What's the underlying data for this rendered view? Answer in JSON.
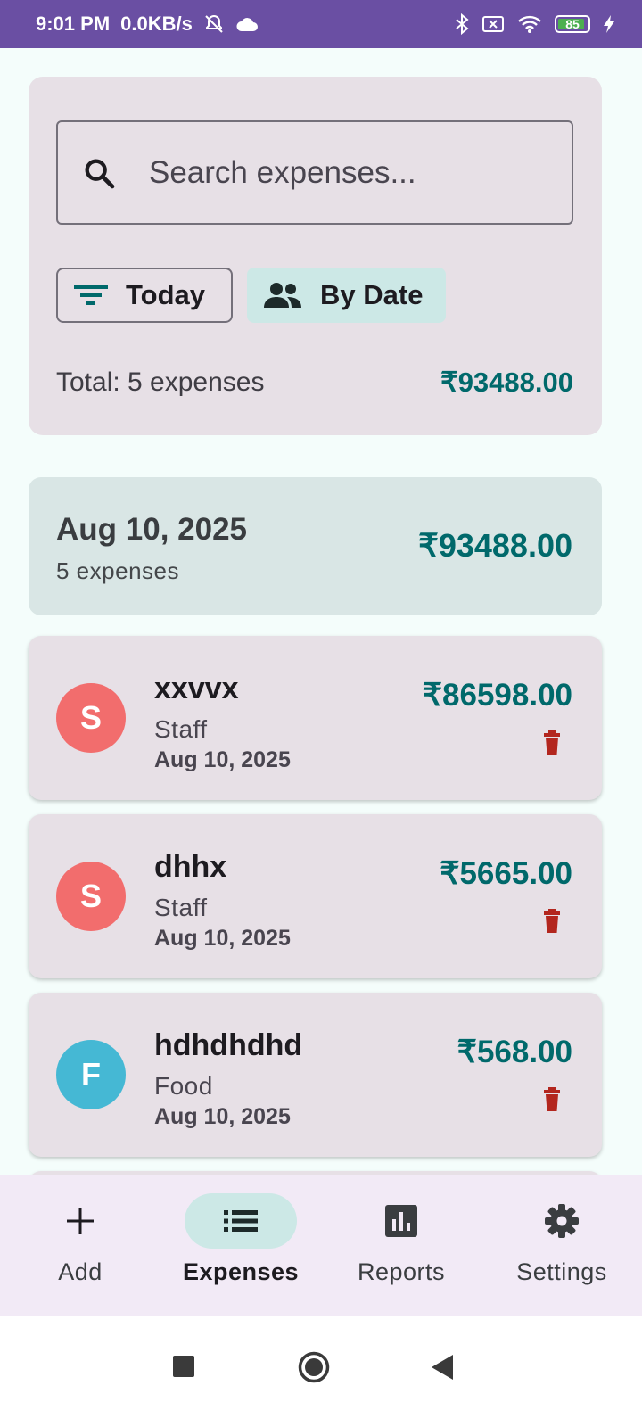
{
  "status_bar": {
    "time": "9:01 PM",
    "speed": "0.0KB/s",
    "battery": "85",
    "background": "#6A4FA3"
  },
  "search": {
    "placeholder": "Search expenses..."
  },
  "filters": {
    "date_filter_label": "Today",
    "group_label": "By Date"
  },
  "summary": {
    "total_label": "Total: 5 expenses",
    "total_amount": "₹93488.00"
  },
  "group": {
    "date": "Aug 10, 2025",
    "count": "5 expenses",
    "amount": "₹93488.00"
  },
  "expenses": [
    {
      "initial": "S",
      "title": "xxvvx",
      "category": "Staff",
      "date": "Aug 10, 2025",
      "amount": "₹86598.00",
      "avatar_color": "#F26D6D"
    },
    {
      "initial": "S",
      "title": "dhhx",
      "category": "Staff",
      "date": "Aug 10, 2025",
      "amount": "₹5665.00",
      "avatar_color": "#F26D6D"
    },
    {
      "initial": "F",
      "title": "hdhdhdhd",
      "category": "Food",
      "date": "Aug 10, 2025",
      "amount": "₹568.00",
      "avatar_color": "#45B8D4"
    }
  ],
  "nav": {
    "items": [
      {
        "label": "Add",
        "icon": "plus-icon",
        "active": false
      },
      {
        "label": "Expenses",
        "icon": "list-icon",
        "active": true
      },
      {
        "label": "Reports",
        "icon": "bar-chart-icon",
        "active": false
      },
      {
        "label": "Settings",
        "icon": "gear-icon",
        "active": false
      }
    ]
  },
  "colors": {
    "accent": "#00696B",
    "delete": "#B3261E",
    "card": "#E7E0E6",
    "active_pill": "#CCE8E6"
  }
}
